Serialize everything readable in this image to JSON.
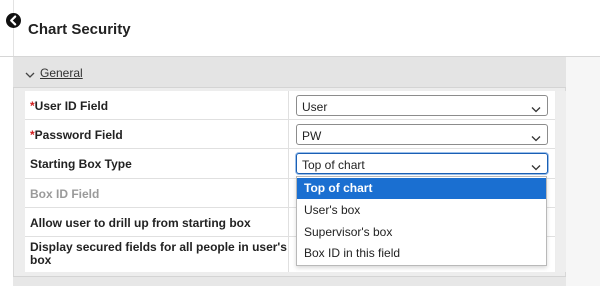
{
  "header": {
    "title": "Chart Security"
  },
  "section": {
    "label": "General"
  },
  "fields": [
    {
      "label": "User ID Field",
      "required": "*",
      "value": "User"
    },
    {
      "label": "Password Field",
      "required": "*",
      "value": "PW"
    },
    {
      "label": "Starting Box Type",
      "value": "Top of chart"
    },
    {
      "label": "Box ID Field"
    },
    {
      "label": "Allow user to drill up from starting box"
    },
    {
      "label": "Display secured fields for all people in user's",
      "label2": "box"
    }
  ],
  "dropdown": {
    "options": [
      "Top of chart",
      "User's box",
      "Supervisor's box",
      "Box ID in this field"
    ],
    "selected": "Top of chart"
  },
  "colors": {
    "accent": "#1a6fd1",
    "required": "#d12020",
    "panel": "#ededed"
  }
}
